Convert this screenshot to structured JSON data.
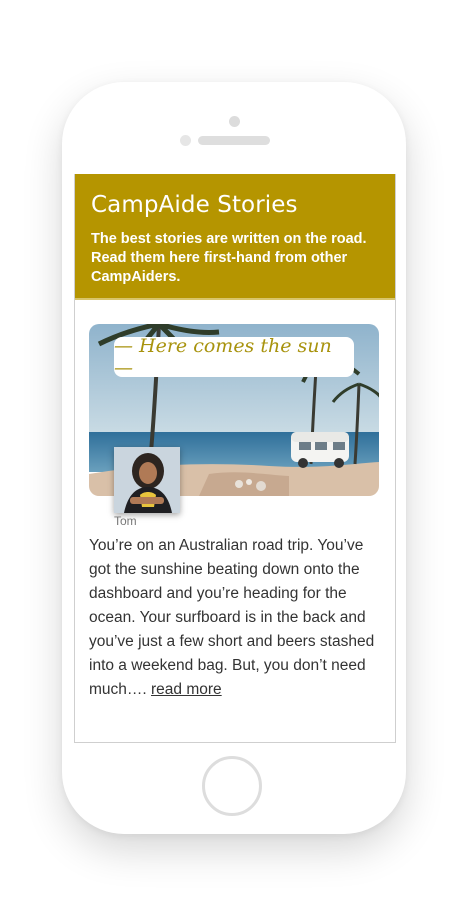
{
  "header": {
    "title": "CampAide Stories",
    "subtitle": "The best stories are written on the road. Read them here first-hand from other CampAiders."
  },
  "story": {
    "tag": "— Here comes the sun —",
    "author": "Tom",
    "excerpt": "You’re on an Australian road trip. You’ve got the sunshine beating down onto the dashboard and you’re heading for the ocean. Your surfboard is in the back and you’ve just a few short and beers stashed into a weekend bag. But, you don’t need much…. ",
    "read_more": "read more"
  },
  "colors": {
    "brand": "#b59500",
    "tag_text": "#a8930e"
  }
}
